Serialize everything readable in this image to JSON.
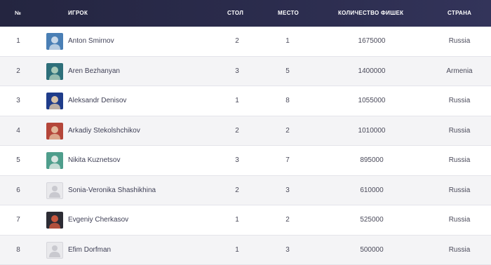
{
  "header": {
    "num": "№",
    "player": "ИГРОК",
    "table": "СТОЛ",
    "seat": "МЕСТО",
    "chips": "КОЛИЧЕСТВО ФИШЕК",
    "country": "СТРАНА"
  },
  "rows": [
    {
      "num": "1",
      "name": "Anton Smirnov",
      "table": "2",
      "seat": "1",
      "chips": "1675000",
      "country": "Russia",
      "avatar": "photo",
      "avatar_colors": [
        "#4a7fb5",
        "#c9d8e8"
      ]
    },
    {
      "num": "2",
      "name": "Aren Bezhanyan",
      "table": "3",
      "seat": "5",
      "chips": "1400000",
      "country": "Armenia",
      "avatar": "photo",
      "avatar_colors": [
        "#2e6f7a",
        "#a8c9b8"
      ]
    },
    {
      "num": "3",
      "name": "Aleksandr Denisov",
      "table": "1",
      "seat": "8",
      "chips": "1055000",
      "country": "Russia",
      "avatar": "photo",
      "avatar_colors": [
        "#1f3c8a",
        "#d7c2a8"
      ]
    },
    {
      "num": "4",
      "name": "Arkadiy Stekolshchikov",
      "table": "2",
      "seat": "2",
      "chips": "1010000",
      "country": "Russia",
      "avatar": "photo",
      "avatar_colors": [
        "#b4463a",
        "#e2b79a"
      ]
    },
    {
      "num": "5",
      "name": "Nikita Kuznetsov",
      "table": "3",
      "seat": "7",
      "chips": "895000",
      "country": "Russia",
      "avatar": "photo",
      "avatar_colors": [
        "#4f9e8c",
        "#d9e5e1"
      ]
    },
    {
      "num": "6",
      "name": "Sonia-Veronika Shashikhina",
      "table": "2",
      "seat": "3",
      "chips": "610000",
      "country": "Russia",
      "avatar": "placeholder",
      "avatar_colors": [
        "#e9e9ec",
        "#c9c9cf"
      ]
    },
    {
      "num": "7",
      "name": "Evgeniy Cherkasov",
      "table": "1",
      "seat": "2",
      "chips": "525000",
      "country": "Russia",
      "avatar": "photo",
      "avatar_colors": [
        "#2c2c34",
        "#c8573e"
      ]
    },
    {
      "num": "8",
      "name": "Efim Dorfman",
      "table": "1",
      "seat": "3",
      "chips": "500000",
      "country": "Russia",
      "avatar": "placeholder",
      "avatar_colors": [
        "#e9e9ec",
        "#c9c9cf"
      ]
    }
  ]
}
